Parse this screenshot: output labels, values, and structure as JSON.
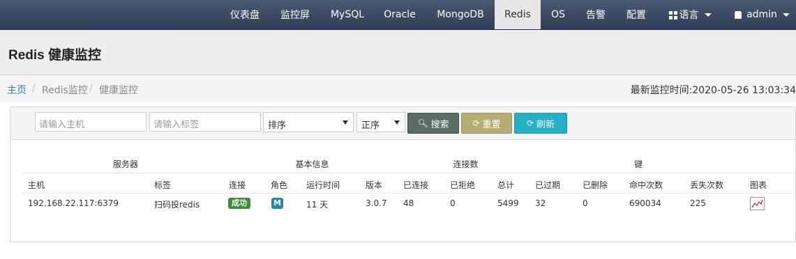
{
  "navbar": {
    "items": [
      {
        "label": "仪表盘"
      },
      {
        "label": "监控屏"
      },
      {
        "label": "MySQL"
      },
      {
        "label": "Oracle"
      },
      {
        "label": "MongoDB"
      },
      {
        "label": "Redis"
      },
      {
        "label": "OS"
      },
      {
        "label": "告警"
      },
      {
        "label": "配置"
      }
    ],
    "active": "Redis",
    "language_label": "语言",
    "user_label": "admin"
  },
  "header": {
    "title": "Redis 健康监控"
  },
  "breadcrumb": {
    "home": "主页",
    "sep": "/",
    "section": "Redis监控",
    "current": "健康监控",
    "last_time_label": "最新监控时间:",
    "last_time_value": "2020-05-26 13:03:34"
  },
  "filters": {
    "host_placeholder": "请输入主机",
    "tag_placeholder": "请输入标签",
    "sort_value": "排序",
    "order_value": "正序",
    "search_label": "搜索",
    "reset_label": "重置",
    "refresh_label": "刷新"
  },
  "table": {
    "groups": [
      "服务器",
      "基本信息",
      "连接数",
      "键"
    ],
    "columns": [
      "主机",
      "标签",
      "连接",
      "角色",
      "运行时间",
      "版本",
      "已连接",
      "已拒绝",
      "总计",
      "已过期",
      "已删除",
      "命中次数",
      "丢失次数",
      "图表"
    ],
    "rows": [
      {
        "host": "192.168.22.117:6379",
        "tag": "扫码投redis",
        "connect": "成功",
        "role": "M",
        "uptime": "11 天",
        "version": "3.0.7",
        "connected": "48",
        "rejected": "0",
        "total": "5499",
        "expired": "32",
        "deleted": "0",
        "hits": "690034",
        "misses": "225"
      }
    ]
  },
  "colors": {
    "navbar": "#3a4a63",
    "success_badge": "#3b8f3a",
    "role_badge": "#2a87a8",
    "link": "#2a7ab8"
  }
}
